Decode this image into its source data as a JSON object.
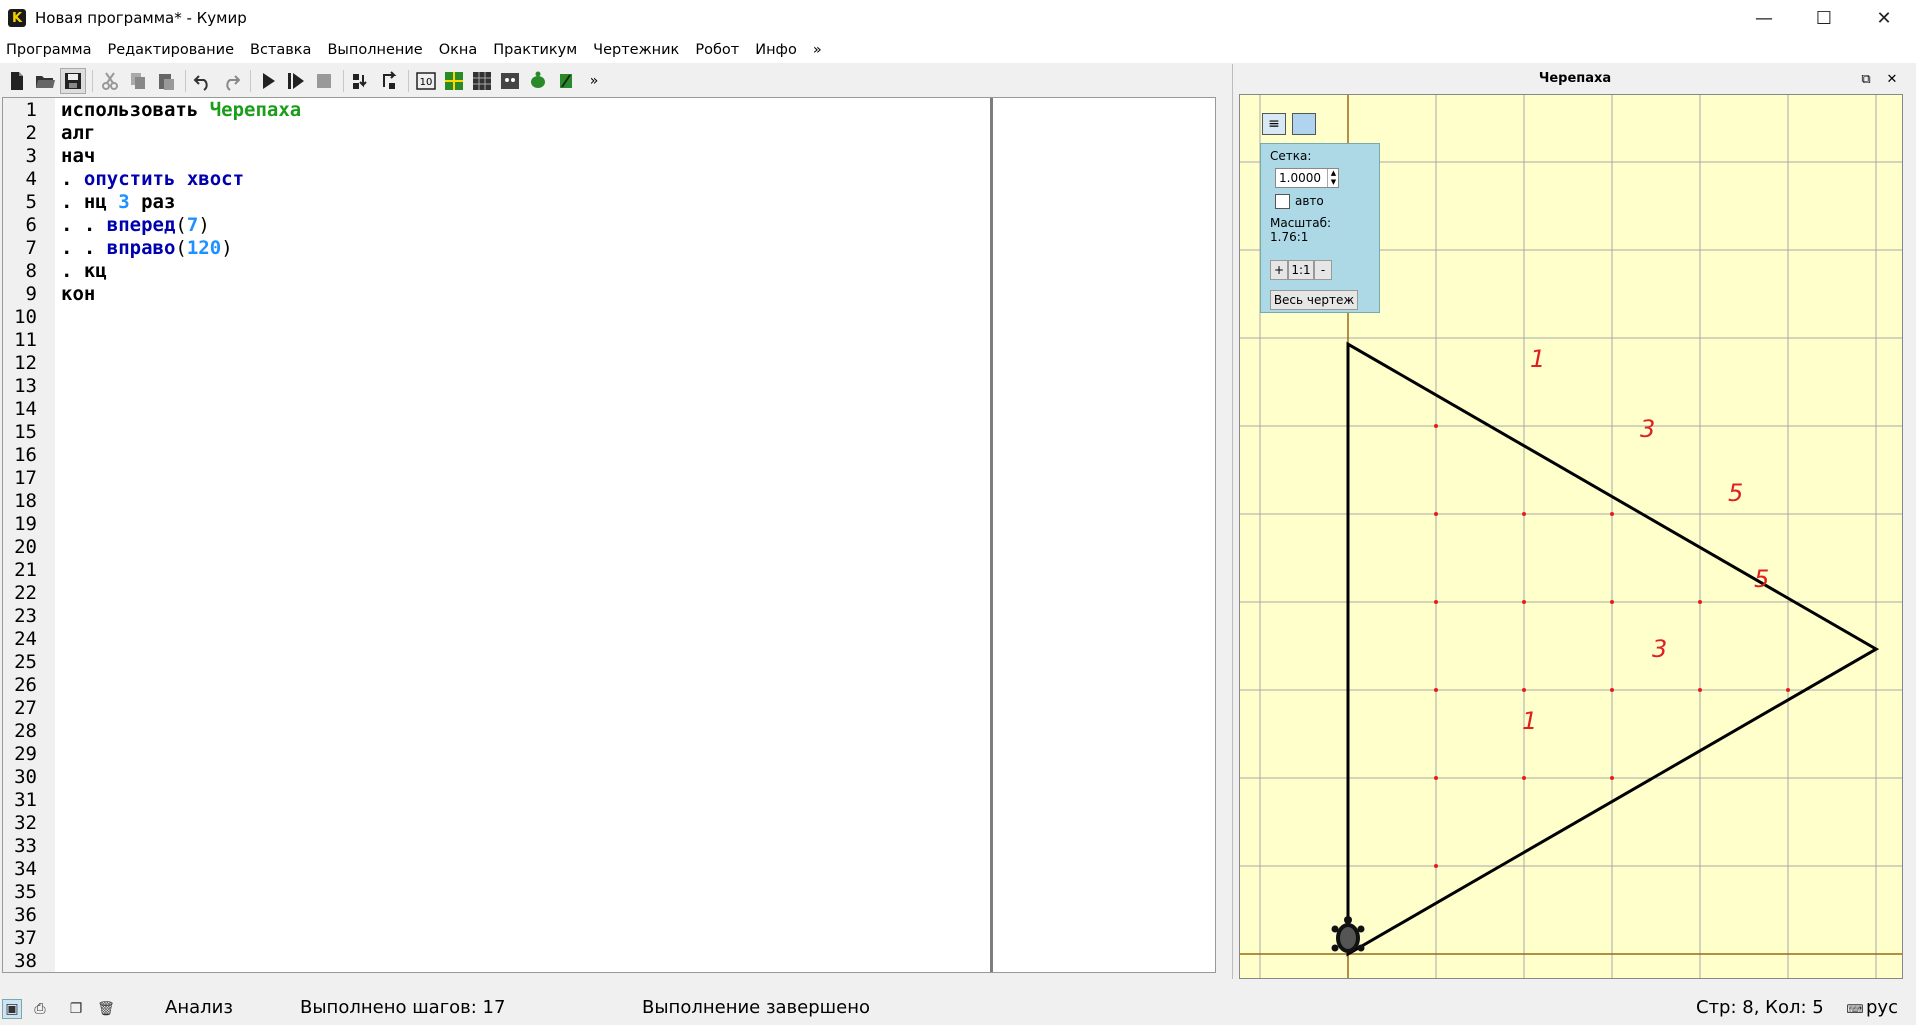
{
  "window": {
    "title": "Новая программа* - Кумир",
    "app_icon_letter": "K",
    "minimize_icon": "minimize-icon",
    "maximize_icon": "maximize-icon",
    "close_icon": "close-icon"
  },
  "menu": [
    "Программа",
    "Редактирование",
    "Вставка",
    "Выполнение",
    "Окна",
    "Практикум",
    "Чертежник",
    "Робот",
    "Инфо",
    "»"
  ],
  "toolbar": {
    "icons": [
      "new-file-icon",
      "open-folder-icon",
      "save-icon",
      "cut-icon",
      "copy-icon",
      "paste-icon",
      "undo-icon",
      "redo-icon",
      "run-icon",
      "run-step-icon",
      "stop-icon",
      "step-in-icon",
      "step-out-icon",
      "counter-icon",
      "grid-icon",
      "table-icon",
      "robot-icon",
      "turtle-icon",
      "draw-icon"
    ],
    "overflow": "»"
  },
  "editor": {
    "line_numbers": [
      "1",
      "2",
      "3",
      "4",
      "5",
      "6",
      "7",
      "8",
      "9",
      "10",
      "11",
      "12",
      "13",
      "14",
      "15",
      "16",
      "17",
      "18",
      "19",
      "20",
      "21",
      "22",
      "23",
      "24",
      "25",
      "26",
      "27",
      "28",
      "29",
      "30",
      "31",
      "32",
      "33",
      "34",
      "35",
      "36",
      "37",
      "38"
    ],
    "lines": [
      {
        "plain": "использовать ",
        "actor": "Черепаха"
      },
      {
        "plain": "алг"
      },
      {
        "plain": "нач"
      },
      {
        "dots": ". ",
        "kw": "опустить хвост"
      },
      {
        "dots": ". ",
        "plain": "нц ",
        "num": "3",
        "tail": " раз"
      },
      {
        "dots": ". . ",
        "kw": "вперед",
        "paren_open": "(",
        "num": "7",
        "paren_close": ")"
      },
      {
        "dots": ". . ",
        "kw": "вправо",
        "paren_open": "(",
        "num": "120",
        "paren_close": ")"
      },
      {
        "dots": ". ",
        "plain": "кц"
      },
      {
        "plain": "кон"
      }
    ]
  },
  "turtle_panel": {
    "title": "Черепаха",
    "grid_label": "Сетка:",
    "grid_value": "1.0000",
    "auto_label": "авто",
    "scale_label": "Масштаб:",
    "scale_value": "1.76:1",
    "zoom_in": "+",
    "zoom_reset": "1:1",
    "zoom_out": "-",
    "whole_drawing": "Весь чертеж",
    "annotations": [
      "1",
      "3",
      "5",
      "5",
      "3",
      "1"
    ]
  },
  "status": {
    "mode": "Анализ",
    "steps": "Выполнено шагов: 17",
    "state": "Выполнение завершено",
    "cursor": "Стр: 8, Кол: 5",
    "lang": "рус"
  }
}
